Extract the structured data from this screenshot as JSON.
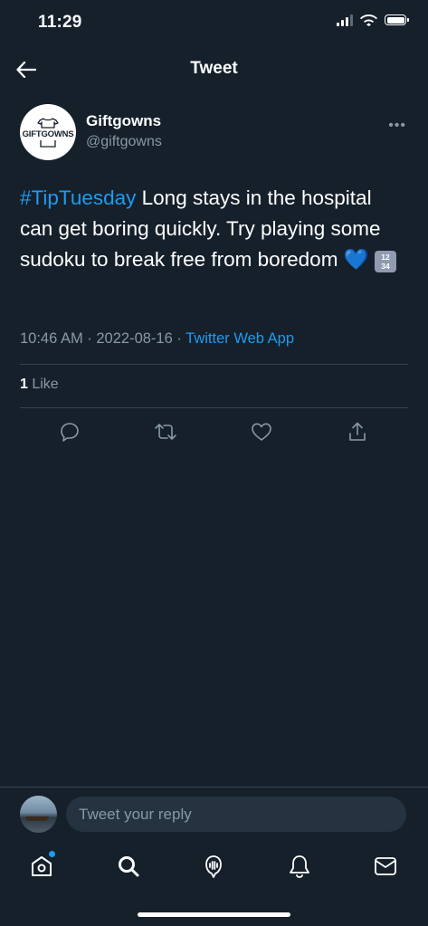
{
  "status_bar": {
    "time": "11:29"
  },
  "header": {
    "title": "Tweet"
  },
  "tweet": {
    "author": {
      "name": "Giftgowns",
      "handle": "@giftgowns",
      "avatar_text": "GIFTGOWNS"
    },
    "hashtag": "#TipTuesday",
    "body": " Long stays in the hospital can get boring quickly. Try playing some sudoku to break free from boredom ",
    "emoji_heart": "💙",
    "emoji_numbers": [
      "12",
      "34"
    ],
    "timestamp": "10:46 AM · 2022-08-16 · ",
    "source": "Twitter Web App",
    "like_count": "1",
    "like_label": " Like"
  },
  "reply": {
    "placeholder": "Tweet your reply"
  },
  "colors": {
    "background": "#15202b",
    "accent": "#1d9bf0",
    "secondary_text": "#8899a6",
    "divider": "#38444d"
  },
  "icons": [
    "back-arrow-icon",
    "more-icon",
    "reply-icon",
    "retweet-icon",
    "like-icon",
    "share-icon",
    "home-icon",
    "search-icon",
    "spaces-icon",
    "notifications-icon",
    "messages-icon"
  ]
}
